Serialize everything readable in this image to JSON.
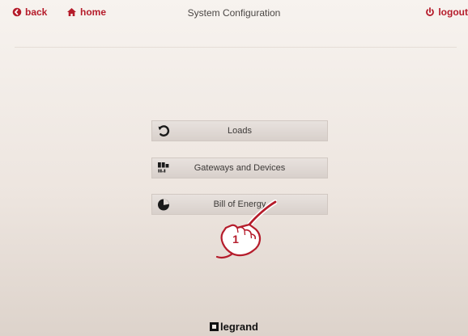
{
  "header": {
    "back_label": "back",
    "home_label": "home",
    "title": "System Configuration",
    "logout_label": "logout"
  },
  "menu": {
    "items": [
      {
        "label": "Loads",
        "icon": "loads-icon"
      },
      {
        "label": "Gateways and Devices",
        "icon": "gateways-devices-icon"
      },
      {
        "label": "Bill of Energy",
        "icon": "bill-of-energy-icon"
      }
    ]
  },
  "annotation": {
    "number": "1"
  },
  "footer": {
    "brand": "legrand"
  },
  "colors": {
    "accent": "#b51c2b",
    "text": "#4b4745",
    "button_bg": "#e2dbd6"
  }
}
